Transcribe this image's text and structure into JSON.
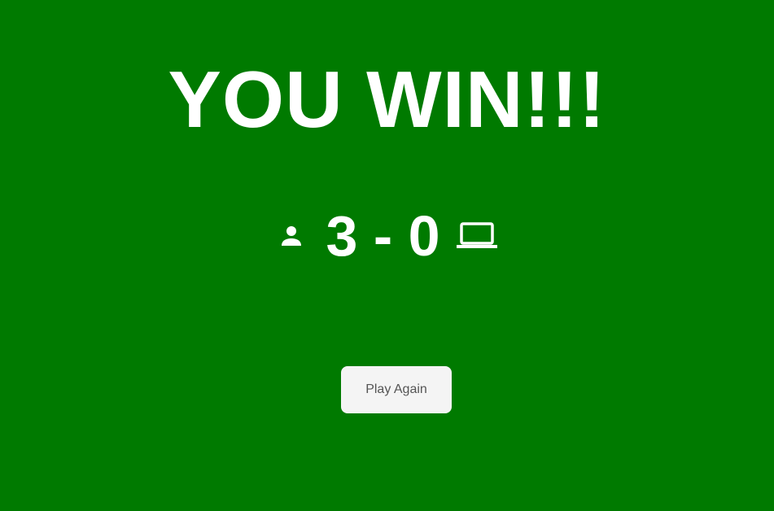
{
  "result": {
    "title": "YOU WIN!!!"
  },
  "score": {
    "text": "3 - 0",
    "player_icon": "person-icon",
    "computer_icon": "laptop-icon"
  },
  "actions": {
    "play_again_label": "Play Again"
  },
  "colors": {
    "background": "#007a00",
    "text": "#ffffff",
    "button_bg": "#f4f4f4",
    "button_text": "#555555"
  }
}
